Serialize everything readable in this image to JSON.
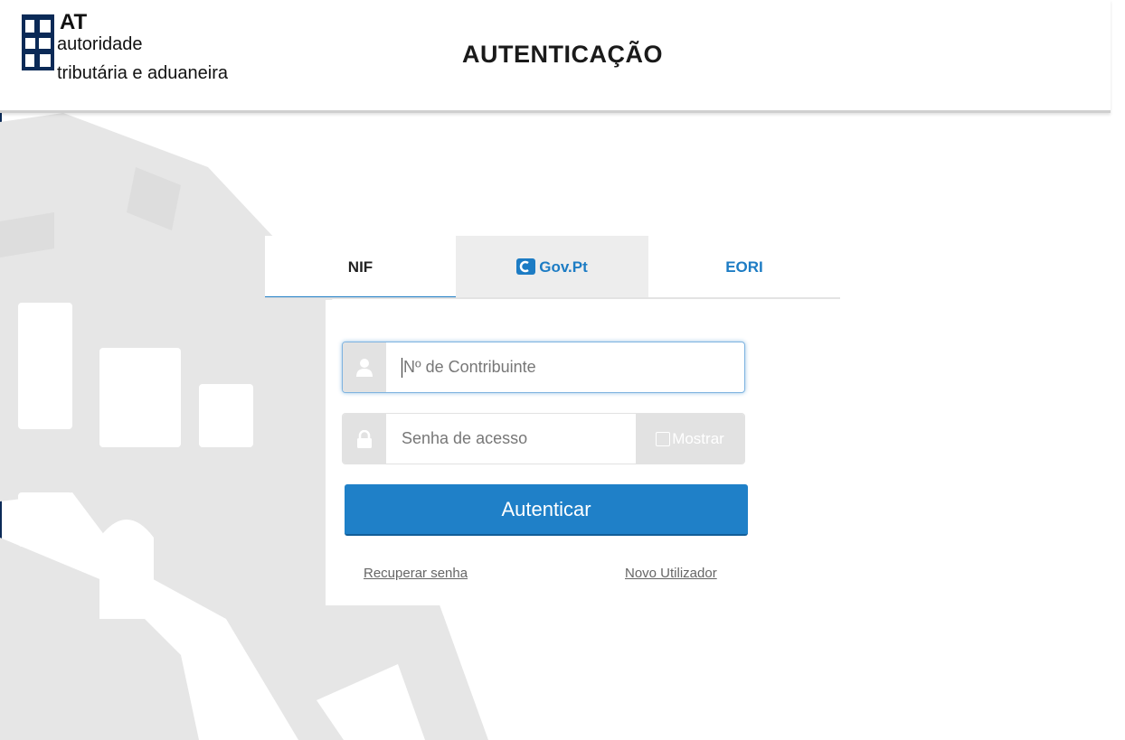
{
  "header": {
    "logo": {
      "abbr": "AT",
      "line1": "autoridade",
      "line2": "tributária e aduaneira"
    },
    "title": "AUTENTICAÇÃO"
  },
  "tabs": [
    {
      "label": "NIF",
      "active": true
    },
    {
      "label": "Gov.Pt",
      "active": false
    },
    {
      "label": "EORI",
      "active": false
    }
  ],
  "form": {
    "nif_placeholder": "Nº de Contribuinte",
    "nif_value": "",
    "password_placeholder": "Senha de acesso",
    "password_value": "",
    "show_label": "Mostrar",
    "show_checked": false,
    "submit_label": "Autenticar",
    "recover_link": "Recuperar senha",
    "new_user_link": "Novo Utilizador"
  },
  "icons": {
    "user": "user-icon",
    "lock": "lock-icon",
    "checkbox": "checkbox-icon",
    "govpt": "govpt-logo-icon",
    "brand": "portuguese-shield-logo-icon"
  },
  "colors": {
    "primary": "#1f80c8",
    "tab_active_underline": "#1d7cc4",
    "brand_navy": "#0b2a57",
    "addon_gray": "#e2e2e2",
    "background_art": "#e6e6e6"
  }
}
